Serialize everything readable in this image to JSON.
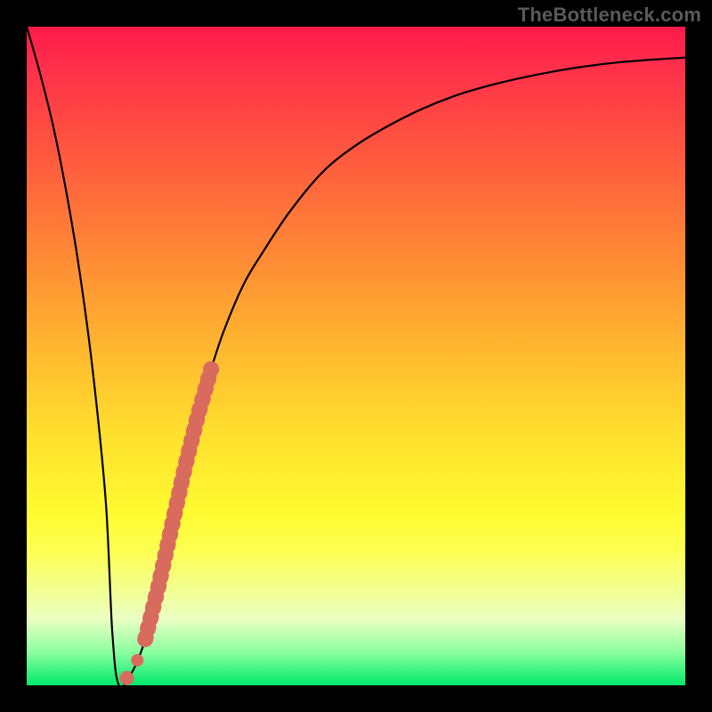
{
  "watermark": "TheBottleneck.com",
  "colors": {
    "gradient_stops": [
      {
        "offset": 0.0,
        "color": "#ff1a4b"
      },
      {
        "offset": 0.06,
        "color": "#ff2f4a"
      },
      {
        "offset": 0.2,
        "color": "#ff5a3e"
      },
      {
        "offset": 0.35,
        "color": "#ff8a35"
      },
      {
        "offset": 0.5,
        "color": "#ffbb2f"
      },
      {
        "offset": 0.62,
        "color": "#ffe02e"
      },
      {
        "offset": 0.74,
        "color": "#fffb31"
      },
      {
        "offset": 0.8,
        "color": "#fcff55"
      },
      {
        "offset": 0.9,
        "color": "#e9ffc3"
      },
      {
        "offset": 0.95,
        "color": "#8aff9f"
      },
      {
        "offset": 1.0,
        "color": "#00e86b"
      }
    ],
    "curve": "#000000",
    "segment": "#d96a5e",
    "frame": "#000000"
  },
  "chart_data": {
    "type": "line",
    "title": "",
    "xlabel": "",
    "ylabel": "",
    "xlim": [
      0,
      100
    ],
    "ylim": [
      0,
      100
    ],
    "grid": false,
    "series": [
      {
        "name": "bottleneck-curve",
        "x": [
          0,
          2,
          4,
          6,
          8,
          10,
          12,
          13,
          14,
          16,
          18,
          20,
          22,
          24,
          26,
          28,
          30,
          33,
          36,
          40,
          45,
          50,
          55,
          60,
          65,
          70,
          75,
          80,
          85,
          90,
          95,
          100
        ],
        "y": [
          100,
          93,
          85,
          75,
          63,
          48,
          28,
          8,
          0,
          2,
          7,
          15,
          24,
          33,
          41,
          48,
          54,
          61,
          66,
          72,
          78,
          82,
          85,
          87.5,
          89.5,
          91,
          92.2,
          93.2,
          94,
          94.6,
          95,
          95.3
        ]
      }
    ],
    "highlight_segment": {
      "note": "visually highlighted dashed salmon segment on the rising arm",
      "x_range": [
        15,
        27
      ],
      "y_range": [
        1,
        44
      ]
    },
    "green_zone_y": [
      0,
      4
    ]
  }
}
